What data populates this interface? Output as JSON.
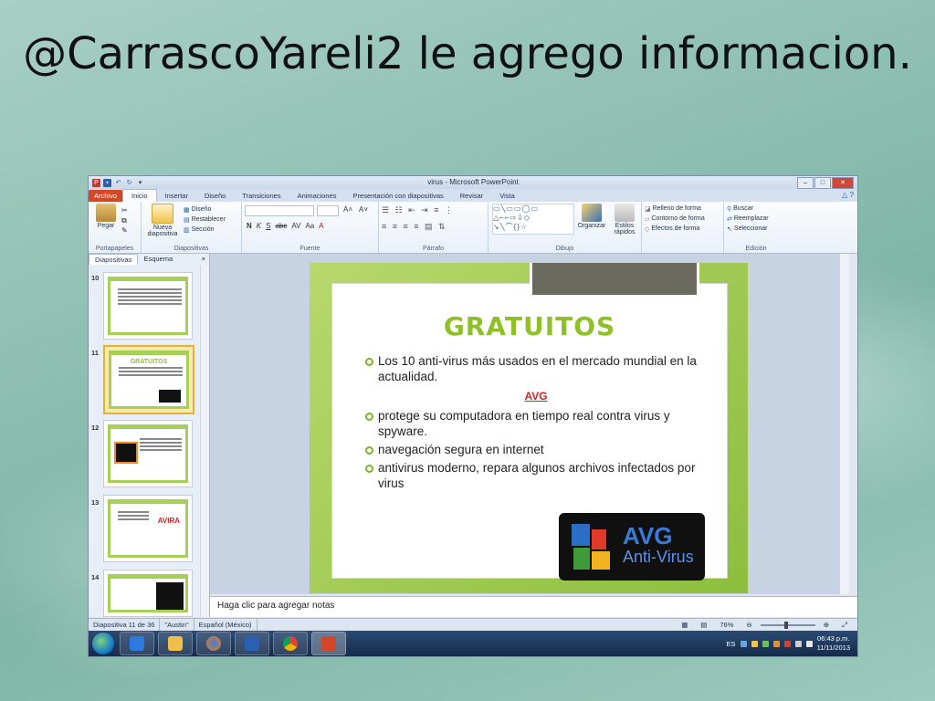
{
  "slide_title": "@CarrascoYareli2 le agrego informacion.",
  "window": {
    "title": "virus - Microsoft PowerPoint",
    "min": "–",
    "max": "□",
    "close": "✕"
  },
  "tabs": [
    "Archivo",
    "Inicio",
    "Insertar",
    "Diseño",
    "Transiciones",
    "Animaciones",
    "Presentación con diapositivas",
    "Revisar",
    "Vista"
  ],
  "ribbon": {
    "portapapeles": {
      "pegar": "Pegar",
      "label": "Portapapeles"
    },
    "diapositivas": {
      "nueva": "Nueva diapositiva",
      "diseno": "Diseño",
      "restablecer": "Restablecer",
      "seccion": "Sección",
      "label": "Diapositivas"
    },
    "fuente": {
      "label": "Fuente",
      "bold": "N",
      "italic": "K",
      "underline": "S",
      "strike": "abc",
      "spacing": "AV",
      "case": "Aa",
      "color": "A"
    },
    "parrafo": {
      "label": "Párrafo"
    },
    "dibujo": {
      "organizar": "Organizar",
      "estilos": "Estilos rápidos",
      "relleno": "Relleno de forma",
      "contorno": "Contorno de forma",
      "efectos": "Efectos de forma",
      "label": "Dibujo"
    },
    "edicion": {
      "buscar": "Buscar",
      "reemplazar": "Reemplazar",
      "seleccionar": "Seleccionar",
      "label": "Edición"
    }
  },
  "panel": {
    "tab_slides": "Diapositivas",
    "tab_outline": "Esquema",
    "close": "×",
    "thumbs": [
      {
        "num": "10",
        "title": ""
      },
      {
        "num": "11",
        "title": "GRATUITOS"
      },
      {
        "num": "12",
        "title": ""
      },
      {
        "num": "13",
        "title": "AVIRA"
      },
      {
        "num": "14",
        "title": ""
      }
    ]
  },
  "slide": {
    "heading": "GRATUITOS",
    "bullet1": "Los 10 anti-virus  más usados en el mercado mundial en la actualidad.",
    "avg_label": "AVG",
    "bullet2": "protege su computadora en tiempo real contra virus y spyware.",
    "bullet3": "navegación segura en internet",
    "bullet4": "antivirus moderno, repara algunos archivos infectados por virus",
    "logo_text": "AVG",
    "logo_sub": "Anti-Virus"
  },
  "notes_placeholder": "Haga clic para agregar notas",
  "status": {
    "slide_info": "Diapositiva 11 de 36",
    "theme": "\"Austin\"",
    "language": "Español (México)",
    "zoom": "76%"
  },
  "taskbar": {
    "lang": "ES",
    "time": "06:43 p.m.",
    "date": "11/11/2013"
  },
  "colors": {
    "accent_green": "#8fbf2b",
    "avg_red": "#d52121",
    "file_tab": "#d24726"
  }
}
